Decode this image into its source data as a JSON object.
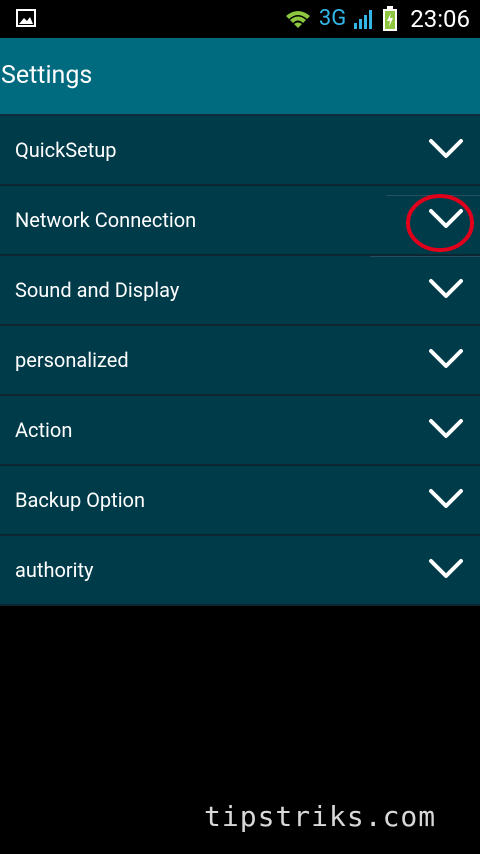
{
  "status_bar": {
    "network_type": "3G",
    "time": "23:06",
    "left_icon": "image-notification-icon",
    "wifi_icon": "wifi-icon",
    "signal_icon": "signal-icon",
    "battery_icon": "battery-charging-icon",
    "net_color": "#33b5e5"
  },
  "action_bar": {
    "title": "Settings",
    "color": "#006a7e"
  },
  "menu": {
    "items": [
      {
        "label": "QuickSetup"
      },
      {
        "label": "Network Connection"
      },
      {
        "label": "Sound and Display"
      },
      {
        "label": "personalized"
      },
      {
        "label": "Action"
      },
      {
        "label": "Backup Option"
      },
      {
        "label": "authority"
      }
    ],
    "item_background": "#003b4a",
    "chevron_icon": "chevron-down-icon"
  },
  "annotation": {
    "highlight_color": "#e0001b"
  },
  "watermark": {
    "text": "tipstriks.com"
  }
}
